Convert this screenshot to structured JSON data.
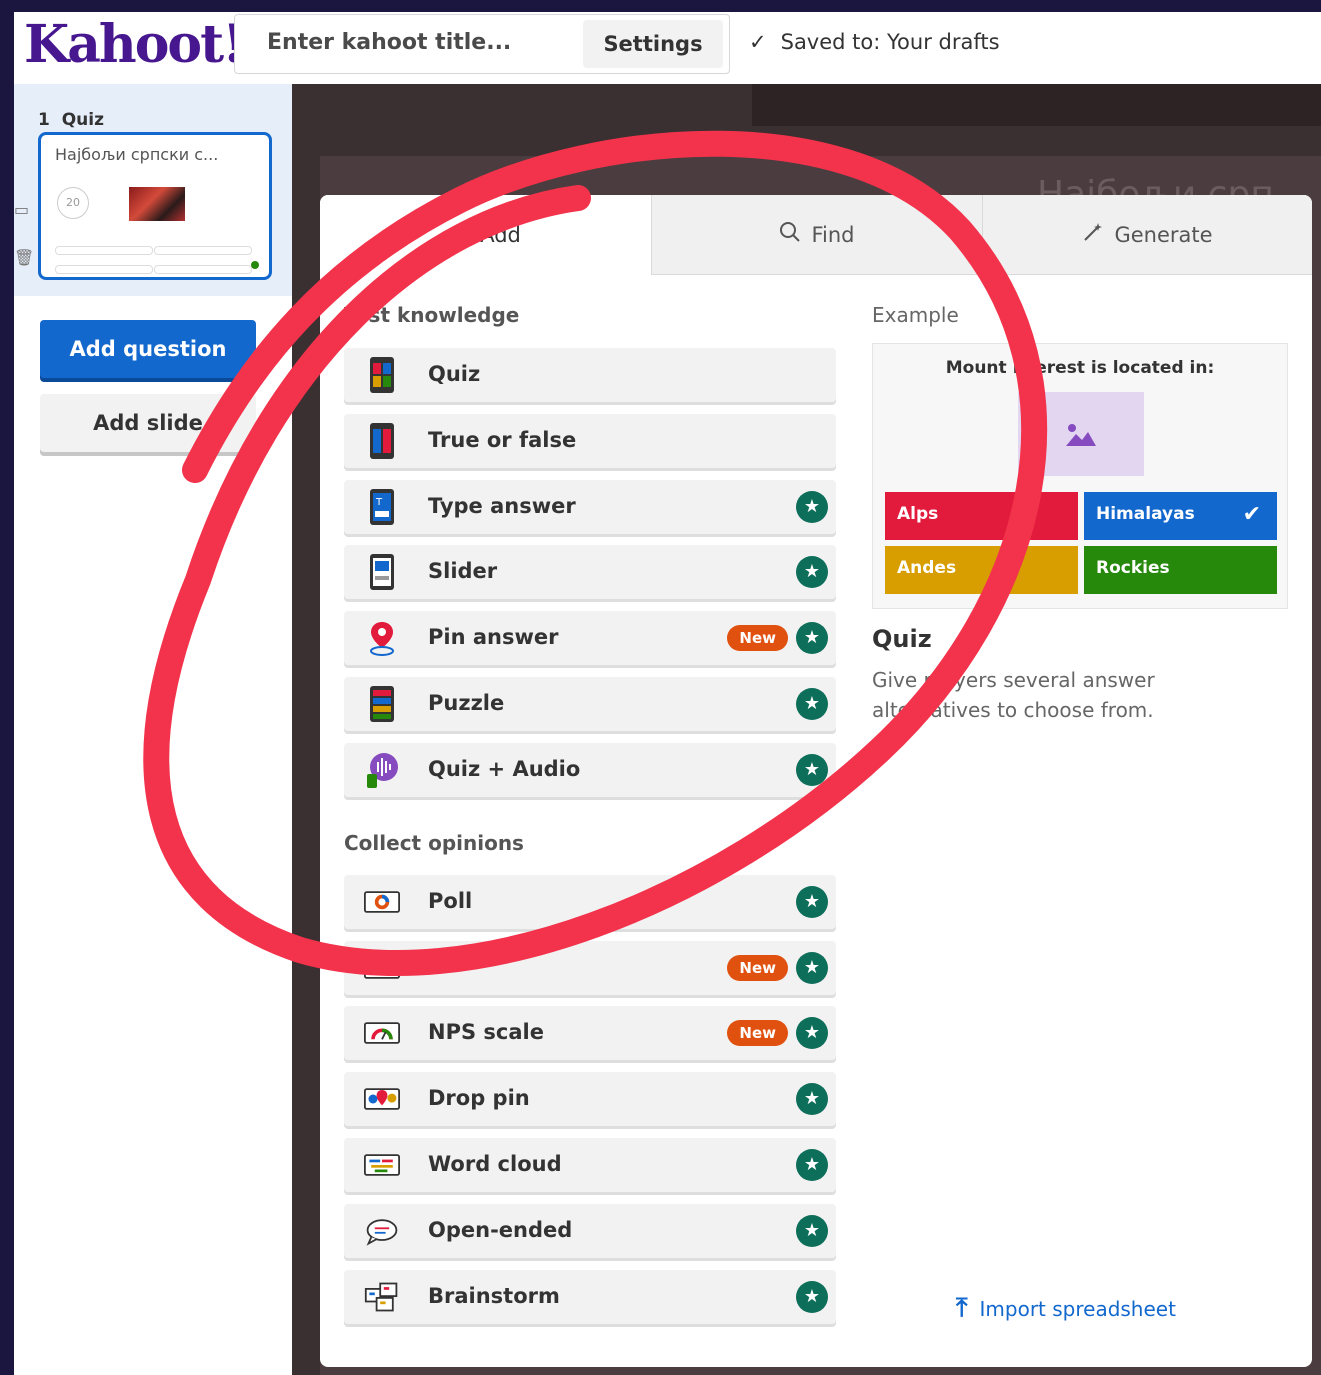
{
  "header": {
    "logo": "Kahoot!",
    "title_placeholder": "Enter kahoot title...",
    "settings_label": "Settings",
    "saved_status": "Saved to: Your drafts"
  },
  "sidebar": {
    "slide_number": "1",
    "slide_type": "Quiz",
    "slide_title": "Најбољи српски с...",
    "slide_timer": "20",
    "add_question_label": "Add question",
    "add_slide_label": "Add slide"
  },
  "canvas": {
    "title_fragment": "Најбољи срп"
  },
  "panel": {
    "tabs": [
      {
        "label": "Add",
        "icon": "plus-icon"
      },
      {
        "label": "Find",
        "icon": "search-icon"
      },
      {
        "label": "Generate",
        "icon": "magic-wand-icon"
      }
    ],
    "sections": [
      {
        "heading": "Test knowledge",
        "items": [
          {
            "label": "Quiz",
            "new": false,
            "premium": false,
            "icon": "quiz-icon"
          },
          {
            "label": "True or false",
            "new": false,
            "premium": false,
            "icon": "true-false-icon"
          },
          {
            "label": "Type answer",
            "new": false,
            "premium": true,
            "icon": "type-answer-icon"
          },
          {
            "label": "Slider",
            "new": false,
            "premium": true,
            "icon": "slider-icon"
          },
          {
            "label": "Pin answer",
            "new": true,
            "premium": true,
            "icon": "pin-answer-icon"
          },
          {
            "label": "Puzzle",
            "new": false,
            "premium": true,
            "icon": "puzzle-icon"
          },
          {
            "label": "Quiz + Audio",
            "new": false,
            "premium": true,
            "icon": "quiz-audio-icon"
          }
        ]
      },
      {
        "heading": "Collect opinions",
        "items": [
          {
            "label": "Poll",
            "new": false,
            "premium": true,
            "icon": "poll-icon"
          },
          {
            "label": "",
            "new": true,
            "premium": true,
            "icon": "scale-icon"
          },
          {
            "label": "NPS scale",
            "new": true,
            "premium": true,
            "icon": "nps-scale-icon"
          },
          {
            "label": "Drop pin",
            "new": false,
            "premium": true,
            "icon": "drop-pin-icon"
          },
          {
            "label": "Word cloud",
            "new": false,
            "premium": true,
            "icon": "word-cloud-icon"
          },
          {
            "label": "Open-ended",
            "new": false,
            "premium": true,
            "icon": "open-ended-icon"
          },
          {
            "label": "Brainstorm",
            "new": false,
            "premium": true,
            "icon": "brainstorm-icon"
          }
        ]
      }
    ],
    "new_badge": "New",
    "example": {
      "label": "Example",
      "question": "Mount Everest is located in:",
      "answers": [
        {
          "text": "Alps",
          "color": "#e21b3c",
          "correct": false
        },
        {
          "text": "Himalayas",
          "color": "#1368ce",
          "correct": true
        },
        {
          "text": "Andes",
          "color": "#d89e00",
          "correct": false
        },
        {
          "text": "Rockies",
          "color": "#26890c",
          "correct": false
        }
      ],
      "title": "Quiz",
      "description": "Give players several answer alternatives to choose from."
    },
    "import_label": "Import spreadsheet"
  },
  "colors": {
    "brand": "#46178f",
    "primary": "#1368ce",
    "premium_star": "#0d6e5a",
    "new_badge": "#e0500f",
    "annotation_circle": "#f2334b"
  }
}
